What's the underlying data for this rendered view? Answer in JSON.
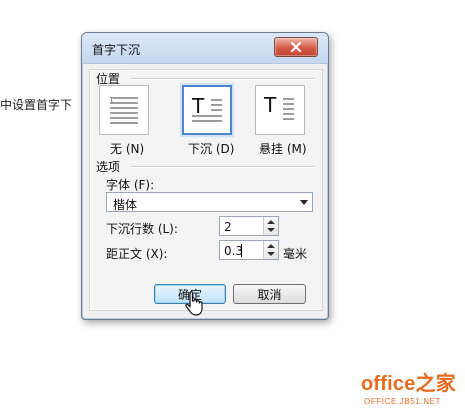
{
  "background": {
    "partial_text": "中设置首字下"
  },
  "dialog": {
    "title": "首字下沉",
    "position_group": {
      "label": "位置",
      "options": [
        {
          "label": "无 (N)",
          "selected": false,
          "icon": "no-dropcap-icon"
        },
        {
          "label": "下沉 (D)",
          "selected": true,
          "icon": "dropped-cap-icon"
        },
        {
          "label": "悬挂 (M)",
          "selected": false,
          "icon": "hanging-cap-icon"
        }
      ]
    },
    "options_group": {
      "label": "选项",
      "font_label": "字体 (F):",
      "font_value": "楷体",
      "lines_label": "下沉行数 (L):",
      "lines_value": "2",
      "distance_label": "距正文 (X):",
      "distance_value": "0.3",
      "distance_unit": "毫米"
    },
    "buttons": {
      "ok": "确定",
      "cancel": "取消"
    }
  },
  "watermark": {
    "main": "office之家",
    "sub": "OFFICE.JB51.NET"
  },
  "colors": {
    "accent": "#4f86c8",
    "watermark": "#e66b21",
    "close_button": "#d45b49"
  }
}
